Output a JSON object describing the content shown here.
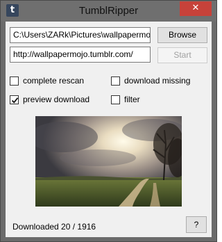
{
  "window": {
    "title": "TumblRipper",
    "app_icon_glyph": "t",
    "close_glyph": "✕"
  },
  "path_field": {
    "value": "C:\\Users\\ZARk\\Pictures\\wallpapermojo"
  },
  "url_field": {
    "value": "http://wallpapermojo.tumblr.com/"
  },
  "buttons": {
    "browse": "Browse",
    "start": "Start",
    "help": "?"
  },
  "options": {
    "complete_rescan": {
      "label": "complete rescan",
      "checked": false
    },
    "download_missing": {
      "label": "download missing",
      "checked": false
    },
    "preview_download": {
      "label": "preview download",
      "checked": true
    },
    "filter": {
      "label": "filter",
      "checked": false
    }
  },
  "status": {
    "text": "Downloaded 20 / 1916"
  },
  "colors": {
    "accent": "#3c7fb1",
    "close": "#c7423a",
    "app_icon": "#36465d"
  }
}
